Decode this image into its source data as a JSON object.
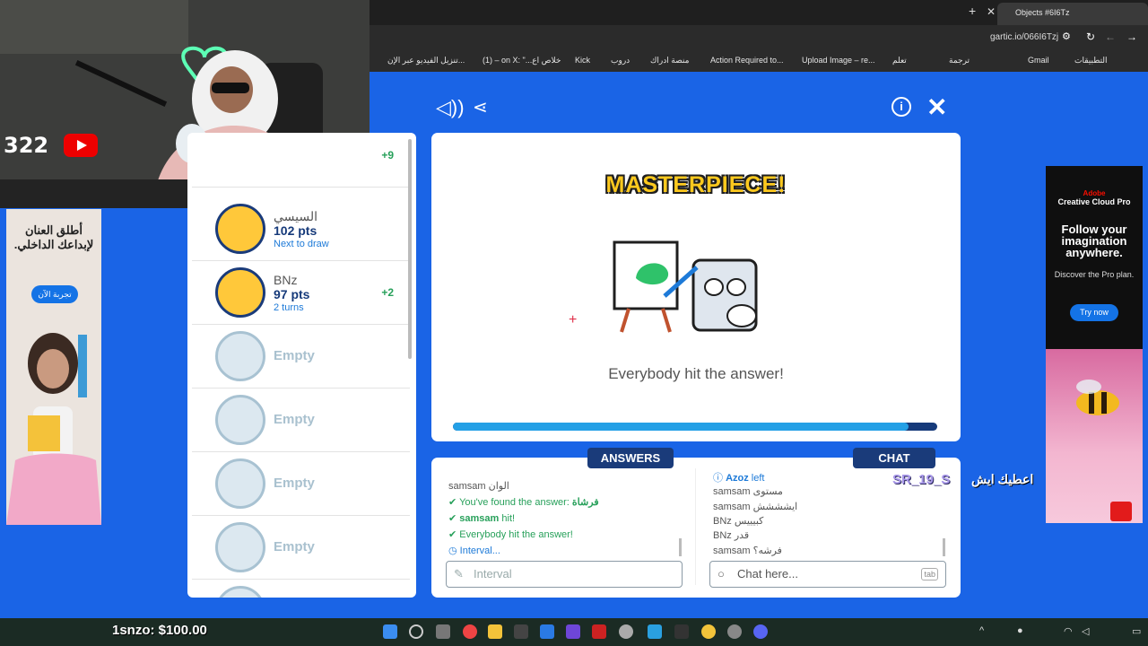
{
  "browser": {
    "tab_title": "Objects #6I6Tz",
    "url": "gartic.io/066I6Tzj",
    "bookmarks": [
      "التطبيقات",
      "Gmail",
      "ترجمة",
      "تعلم",
      "Upload Image – re...",
      "Action Required to...",
      "منصة ادراك",
      "دروب",
      "Kick",
      "(1) – on X: \"...خلاص اع",
      "تنزيل الفيديو عبر الإن..."
    ]
  },
  "stream": {
    "viewer_count": "322",
    "money": "1snzo: $100.00",
    "chat_user": "SR_19_S",
    "chat_msg": "اعطيك ايش"
  },
  "left_ad": {
    "text": "أطلق العنان لإبداعك الداخلي.",
    "button": "تجربة الآن"
  },
  "right_ad": {
    "brand": "Adobe",
    "product": "Creative Cloud Pro",
    "headline": "Follow your imagination anywhere.",
    "sub": "Discover the Pro plan.",
    "button": "Try now"
  },
  "players": [
    {
      "bonus": "+9"
    },
    {
      "name": "السيسي",
      "pts": "102 pts",
      "sub": "Next to draw"
    },
    {
      "name": "BNz",
      "pts": "97 pts",
      "sub": "2 turns",
      "bonus": "+2"
    },
    {
      "name": "Empty"
    },
    {
      "name": "Empty"
    },
    {
      "name": "Empty"
    },
    {
      "name": "Empty"
    }
  ],
  "board": {
    "title": "MASTERPIECE!",
    "message": "Everybody hit the answer!",
    "progress": 0.94
  },
  "answers": {
    "header": "ANSWERS",
    "lines": [
      {
        "user": "samsam",
        "text": "الوان"
      },
      {
        "prefix": "You've found the answer: ",
        "answer": "فرشاة"
      },
      {
        "user": "samsam",
        "text": " hit!"
      },
      {
        "text": "Everybody hit the answer!"
      },
      {
        "text": "Interval..."
      }
    ],
    "placeholder": "Interval"
  },
  "chat": {
    "header": "CHAT",
    "lines": [
      {
        "user": "Azoz",
        "text": " left"
      },
      {
        "user": "samsam",
        "text": "مستوى"
      },
      {
        "user": "samsam",
        "text": "ايشششش"
      },
      {
        "user": "BNz",
        "text": "كبيييس"
      },
      {
        "user": "BNz",
        "text": "قدر"
      },
      {
        "user": "samsam",
        "text": "فرشه؟"
      }
    ],
    "placeholder": "Chat here...",
    "tab_hint": "tab"
  }
}
